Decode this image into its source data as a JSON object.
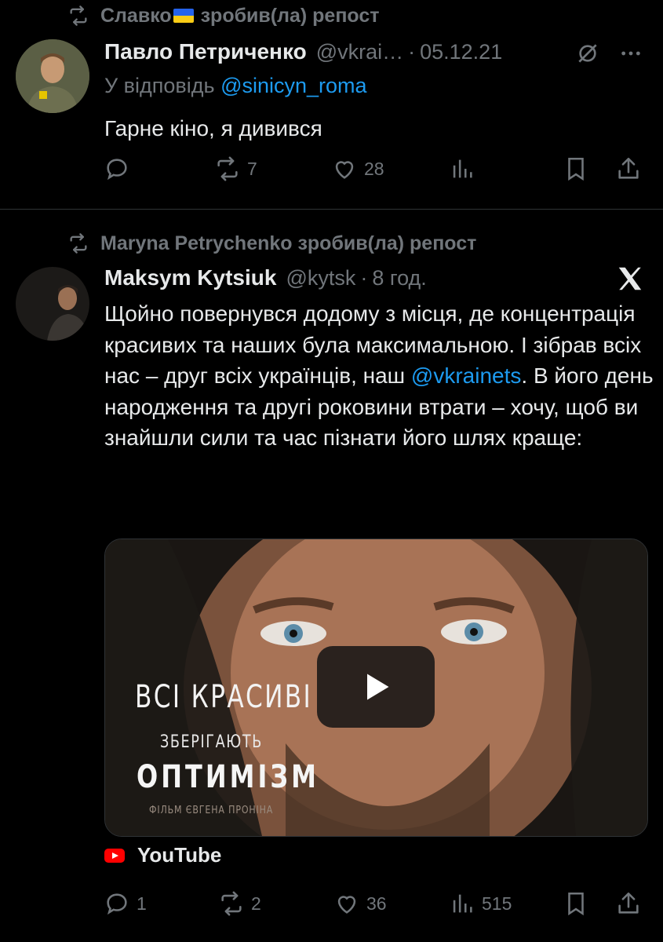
{
  "post1": {
    "repost_by": "Славко",
    "repost_suffix": "зробив(ла) репост",
    "author_name": "Павло Петриченко",
    "author_handle": "@vkrai…",
    "time": "05.12.21",
    "reply_to_prefix": "У відповідь",
    "reply_to_handle": "@sinicyn_roma",
    "text": "Гарне кіно, я дивився",
    "stats": {
      "reposts": "7",
      "likes": "28"
    }
  },
  "post2": {
    "repost_line": "Maryna Petrychenko зробив(ла) репост",
    "author_name": "Maksym Kytsiuk",
    "author_handle": "@kytsk",
    "time": "8 год.",
    "text_before": "Щойно повернувся додому з місця, де концентрація красивих та наших була максимальною. І зібрав всіх нас – друг всіх українців, наш ",
    "mention": "@vkrainets",
    "text_after": ". В його день народження та другі роковини втрати – хочу, щоб ви знайшли сили та час пізнати його шлях краще:",
    "media": {
      "title_line1": "ВСІ КРАСИВІ",
      "title_line2": "ЗБЕРІГАЮТЬ",
      "title_line3": "ОПТИМІЗМ",
      "credit": "ФІЛЬМ ЄВГЕНА ПРОНІНА"
    },
    "source": "YouTube",
    "stats": {
      "replies": "1",
      "reposts": "2",
      "likes": "36",
      "views": "515"
    }
  },
  "icons": [
    "repost-icon",
    "grok-icon",
    "more-icon",
    "x-logo-icon",
    "reply-icon",
    "like-icon",
    "views-icon",
    "bookmark-icon",
    "share-icon",
    "play-icon",
    "youtube-icon"
  ]
}
